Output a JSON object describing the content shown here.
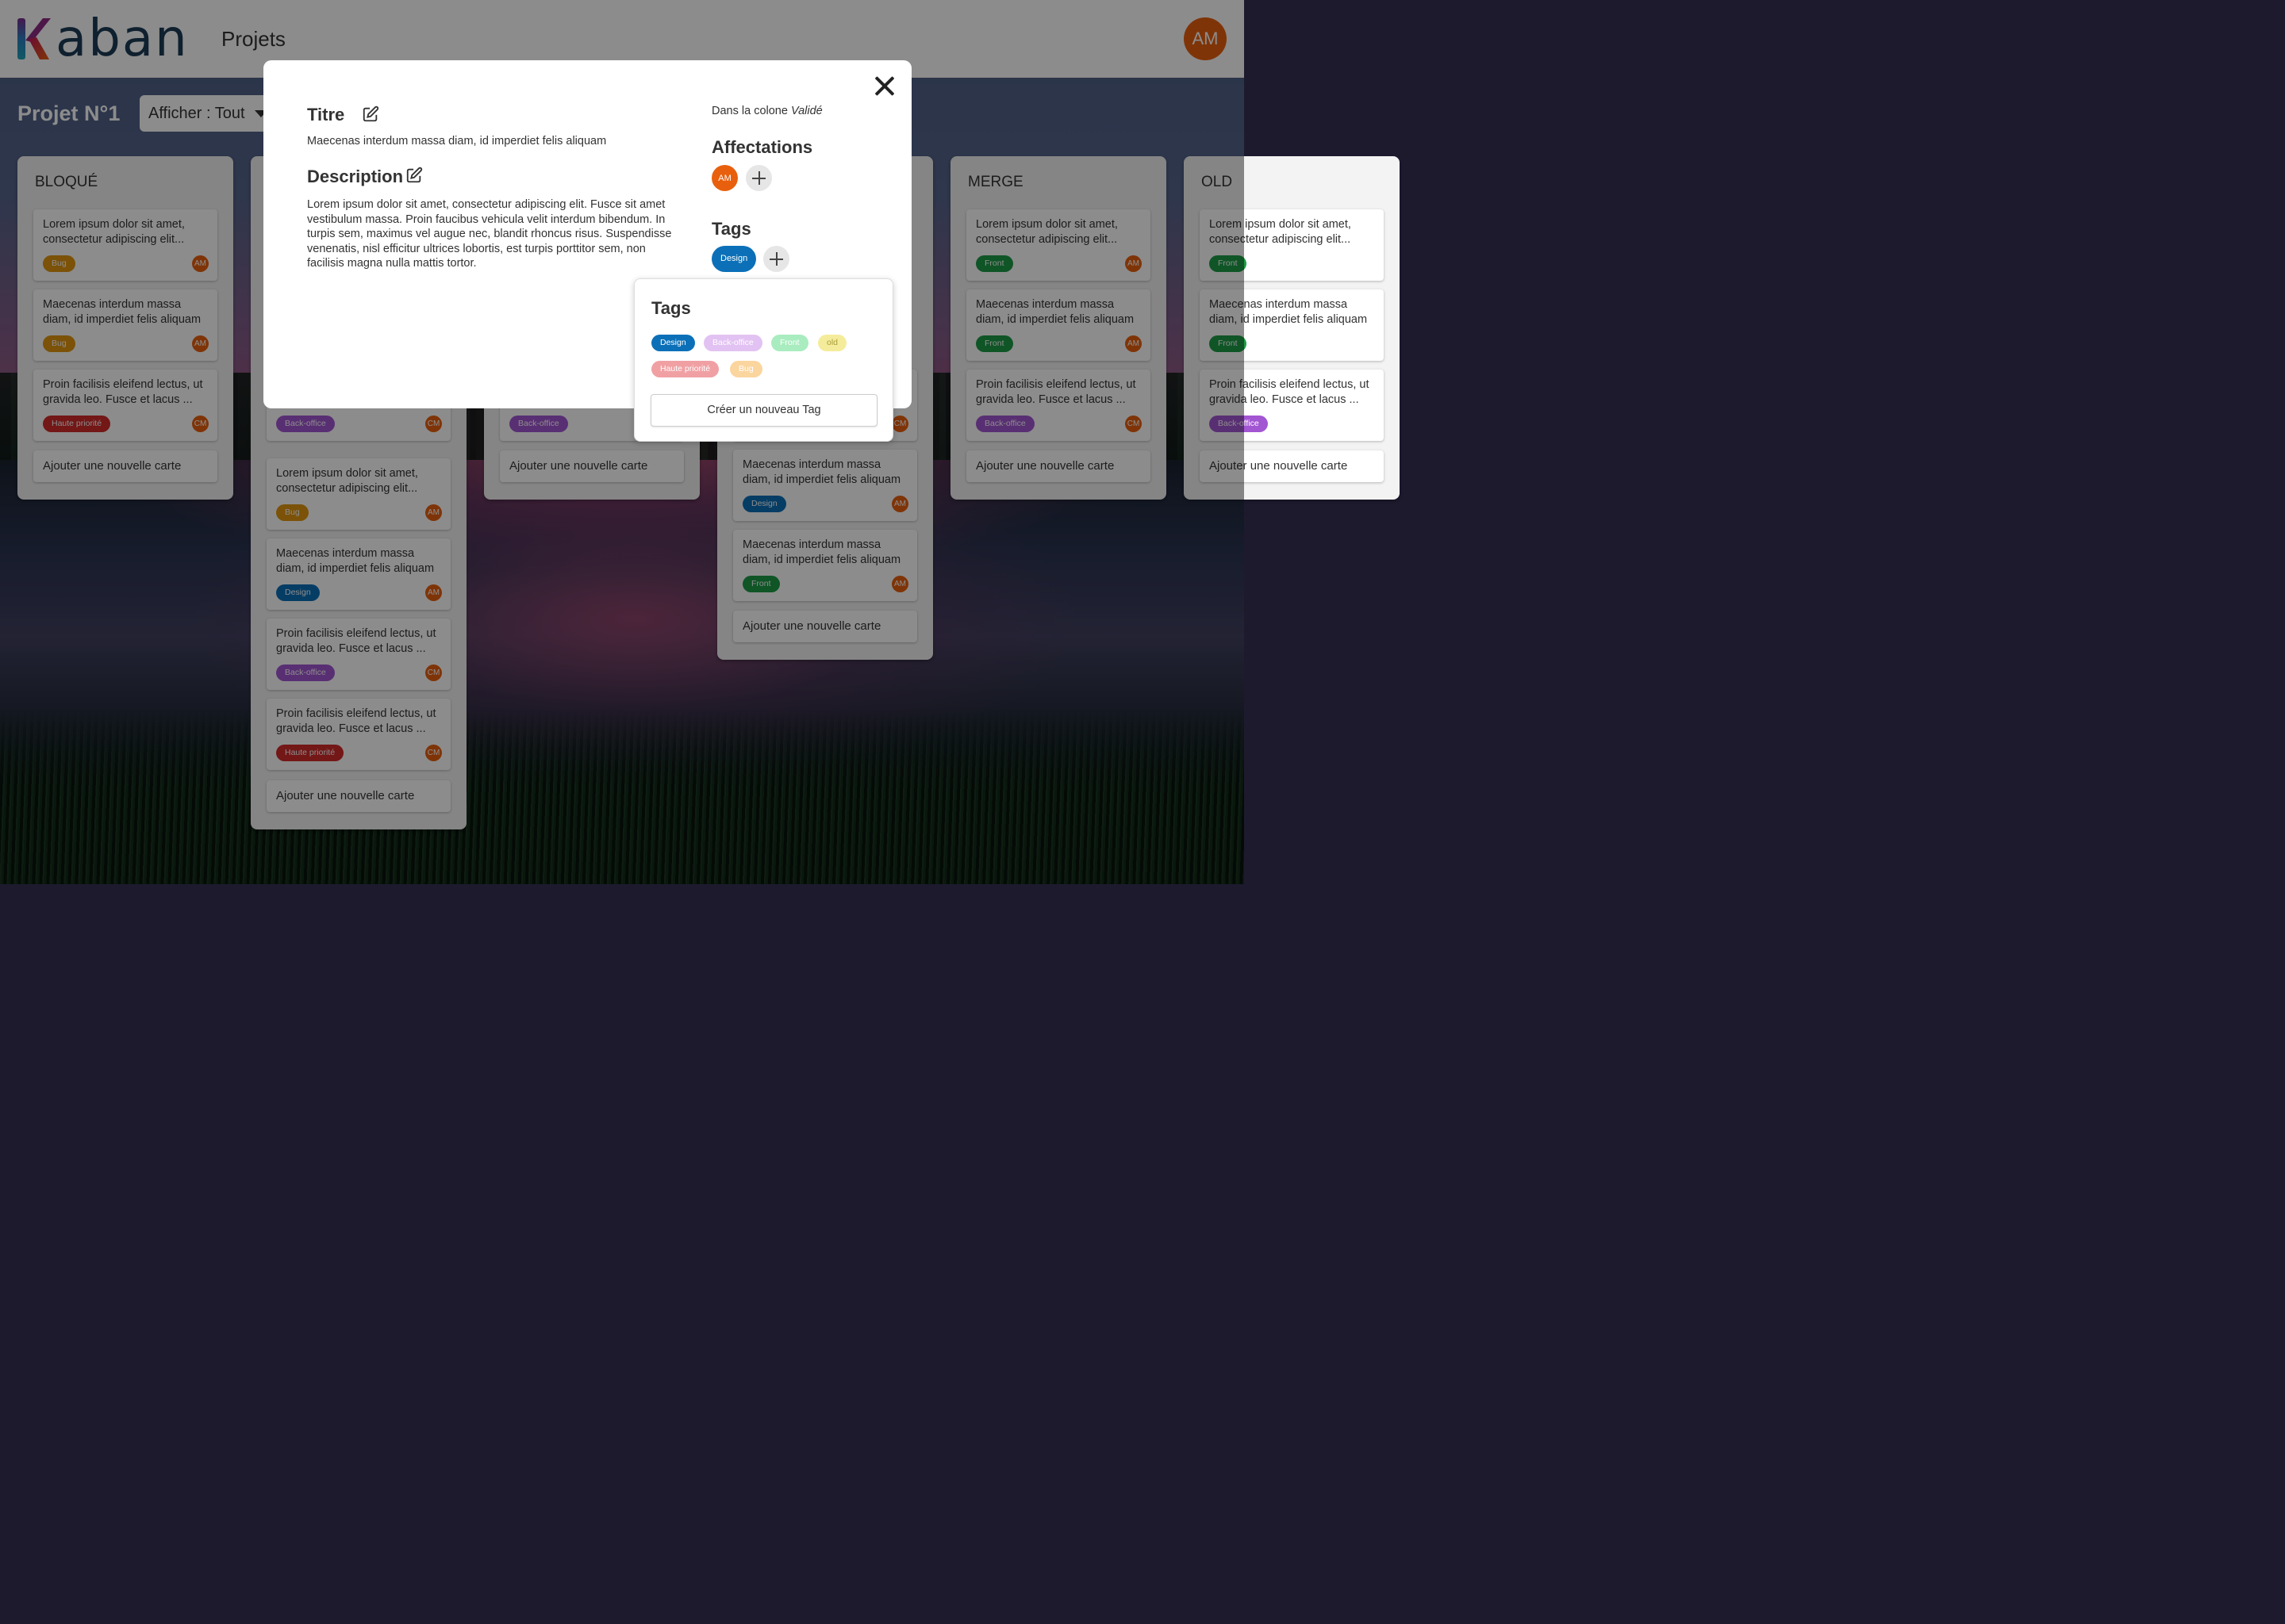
{
  "header": {
    "logo_text": "aban",
    "nav_projets": "Projets",
    "user_initials": "AM"
  },
  "toolbar": {
    "project_title": "Projet N°1",
    "filter_label": "Afficher : Tout"
  },
  "columns": [
    {
      "title": "BLOQUÉ",
      "cards": [
        {
          "text": "Lorem ipsum dolor sit amet, consectetur adipiscing elit...",
          "tag": "Bug",
          "user": "AM"
        },
        {
          "text": "Maecenas interdum massa diam, id imperdiet felis aliquam",
          "tag": "Bug",
          "user": "AM"
        },
        {
          "text": "Proin facilisis eleifend lectus, ut gravida leo. Fusce et lacus ...",
          "tag": "Haute priorité",
          "user": "CM"
        }
      ],
      "add_label": "Ajouter une nouvelle carte"
    },
    {
      "title": "",
      "cards": [
        {
          "text": "",
          "tag": "Back-office",
          "user": "CM"
        },
        {
          "text": "Lorem ipsum dolor sit amet, consectetur adipiscing elit...",
          "tag": "Bug",
          "user": "AM"
        },
        {
          "text": "Maecenas interdum massa diam, id imperdiet felis aliquam",
          "tag": "Design",
          "user": "AM"
        },
        {
          "text": "Proin facilisis eleifend lectus, ut gravida leo. Fusce et lacus ...",
          "tag": "Back-office",
          "user": "CM"
        },
        {
          "text": "Proin facilisis eleifend lectus, ut gravida leo. Fusce et lacus ...",
          "tag": "Haute priorité",
          "user": "CM"
        }
      ],
      "add_label": "Ajouter une nouvelle carte"
    },
    {
      "title": "",
      "cards": [
        {
          "text": "",
          "tag": "Back-office",
          "user": ""
        }
      ],
      "add_label": "Ajouter une nouvelle carte"
    },
    {
      "title": "",
      "cards": [
        {
          "text": "",
          "tag": "",
          "user": "CM"
        },
        {
          "text": "Maecenas interdum massa diam, id imperdiet felis aliquam",
          "tag": "Design",
          "user": "AM"
        },
        {
          "text": "Maecenas interdum massa diam, id imperdiet felis aliquam",
          "tag": "Front",
          "user": "AM"
        }
      ],
      "add_label": "Ajouter une nouvelle carte"
    },
    {
      "title": "MERGE",
      "cards": [
        {
          "text": "Lorem ipsum dolor sit amet, consectetur adipiscing elit...",
          "tag": "Front",
          "user": "AM"
        },
        {
          "text": "Maecenas interdum massa diam, id imperdiet felis aliquam",
          "tag": "Front",
          "user": "AM"
        },
        {
          "text": "Proin facilisis eleifend lectus, ut gravida leo. Fusce et lacus ...",
          "tag": "Back-office",
          "user": "CM"
        }
      ],
      "add_label": "Ajouter une nouvelle carte"
    },
    {
      "title": "OLD",
      "cards": [
        {
          "text": "Lorem ipsum dolor sit amet, consectetur adipiscing elit...",
          "tag": "Front",
          "user": ""
        },
        {
          "text": "Maecenas interdum massa diam, id imperdiet felis aliquam",
          "tag": "Front",
          "user": ""
        },
        {
          "text": "Proin facilisis eleifend lectus, ut gravida leo. Fusce et lacus ...",
          "tag": "Back-office",
          "user": ""
        }
      ],
      "add_label": "Ajouter une nouvelle carte"
    }
  ],
  "modal": {
    "title_heading": "Titre",
    "title_value": "Maecenas interdum massa diam, id imperdiet felis aliquam",
    "description_heading": "Description",
    "description_value": "Lorem ipsum dolor sit amet, consectetur adipiscing elit. Fusce sit amet vestibulum massa. Proin faucibus vehicula velit interdum bibendum. In turpis sem, maximus vel augue nec, blandit rhoncus risus. Suspendisse venenatis, nisl efficitur ultrices lobortis, est turpis porttitor sem, non facilisis magna nulla mattis tortor.",
    "column_prefix": "Dans la colone ",
    "column_name": "Validé",
    "affectations_heading": "Affectations",
    "assignee": "AM",
    "tags_heading": "Tags",
    "current_tag": "Design"
  },
  "tags_popover": {
    "title": "Tags",
    "tags": [
      "Design",
      "Back-office",
      "Front",
      "old",
      "Haute priorité",
      "Bug"
    ],
    "create_label": "Créer un nouveau Tag"
  },
  "colors": {
    "Design": "#0b70b8",
    "Back-office": "#a256d2",
    "Front": "#1d9c46",
    "Bug": "#e1950f",
    "Haute priorité": "#d22a2a",
    "old": "#f0e06a",
    "avatar": "#e8600d",
    "logo_navy": "#1d3b57"
  }
}
